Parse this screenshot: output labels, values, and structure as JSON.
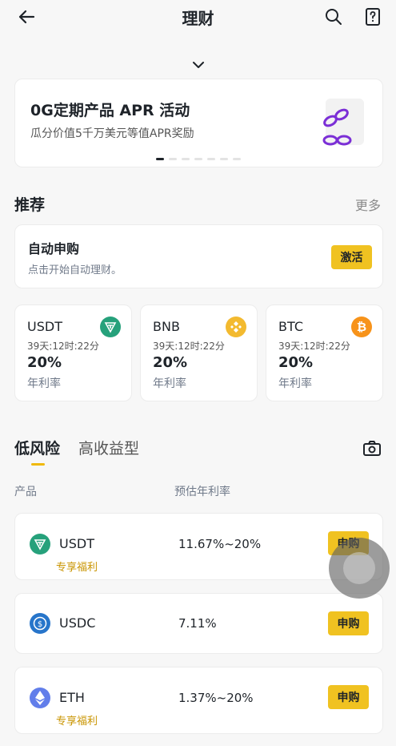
{
  "header": {
    "title": "理财",
    "back_icon": "arrow-left-icon",
    "search_icon": "search-icon",
    "help_icon": "help-icon"
  },
  "banner": {
    "title": "0G定期产品 APR 活动",
    "subtitle": "瓜分价值5千万美元等值APR奖励",
    "dots_total": 7,
    "dots_active": 1
  },
  "recommend": {
    "title": "推荐",
    "more": "更多",
    "auto": {
      "title": "自动申购",
      "subtitle": "点击开始自动理财。",
      "button": "激活"
    },
    "cards": [
      {
        "name": "USDT",
        "time": "39天:12时:22分",
        "rate": "20%",
        "label": "年利率",
        "coin": "tether-icon",
        "color": "#26a17b"
      },
      {
        "name": "BNB",
        "time": "39天:12时:22分",
        "rate": "20%",
        "label": "年利率",
        "coin": "bnb-icon",
        "color": "#f3ba2f"
      },
      {
        "name": "BTC",
        "time": "39天:12时:22分",
        "rate": "20%",
        "label": "年利率",
        "coin": "bitcoin-icon",
        "color": "#f7931a"
      }
    ]
  },
  "tabs": {
    "low_risk": "低风险",
    "high_yield": "高收益型"
  },
  "table": {
    "columns": [
      "产品",
      "预估年利率"
    ],
    "rows": [
      {
        "name": "USDT",
        "apr": "11.67%~20%",
        "tag": "专享福利",
        "button": "申购",
        "coin": "tether-icon",
        "color": "#26a17b"
      },
      {
        "name": "USDC",
        "apr": "7.11%",
        "tag": "",
        "button": "申购",
        "coin": "usdc-icon",
        "color": "#2775ca"
      },
      {
        "name": "ETH",
        "apr": "1.37%~20%",
        "tag": "专享福利",
        "button": "申购",
        "coin": "ethereum-icon",
        "color": "#627eea"
      }
    ]
  },
  "colors": {
    "accent": "#f0c221",
    "text": "#1e2329",
    "muted": "#707a8a",
    "tag": "#c99400"
  }
}
